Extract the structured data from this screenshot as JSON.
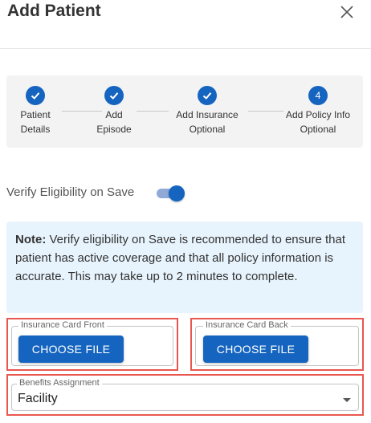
{
  "header": {
    "title": "Add Patient",
    "close_icon": "close-icon"
  },
  "stepper": {
    "steps": [
      {
        "line1": "Patient",
        "line2": "Details",
        "state": "complete",
        "icon": "check-icon"
      },
      {
        "line1": "Add",
        "line2": "Episode",
        "state": "complete",
        "icon": "check-icon"
      },
      {
        "line1": "Add Insurance",
        "line2": "Optional",
        "state": "complete",
        "icon": "check-icon"
      },
      {
        "line1": "Add Policy Info",
        "line2": "Optional",
        "state": "active",
        "number": "4"
      }
    ],
    "accent_color": "#1565c0"
  },
  "verify": {
    "label": "Verify Eligibility on Save",
    "enabled": true
  },
  "note": {
    "bold": "Note:",
    "text": " Verify eligibility on Save is recommended to ensure that patient has active coverage and that all policy information is accurate. This may take up to 2 minutes to complete."
  },
  "insurance_front": {
    "legend": "Insurance Card Front",
    "button": "CHOOSE FILE"
  },
  "insurance_back": {
    "legend": "Insurance Card Back",
    "button": "CHOOSE FILE"
  },
  "benefits": {
    "legend": "Benefits Assignment",
    "value": "Facility"
  },
  "highlight_color": "#e8574f"
}
